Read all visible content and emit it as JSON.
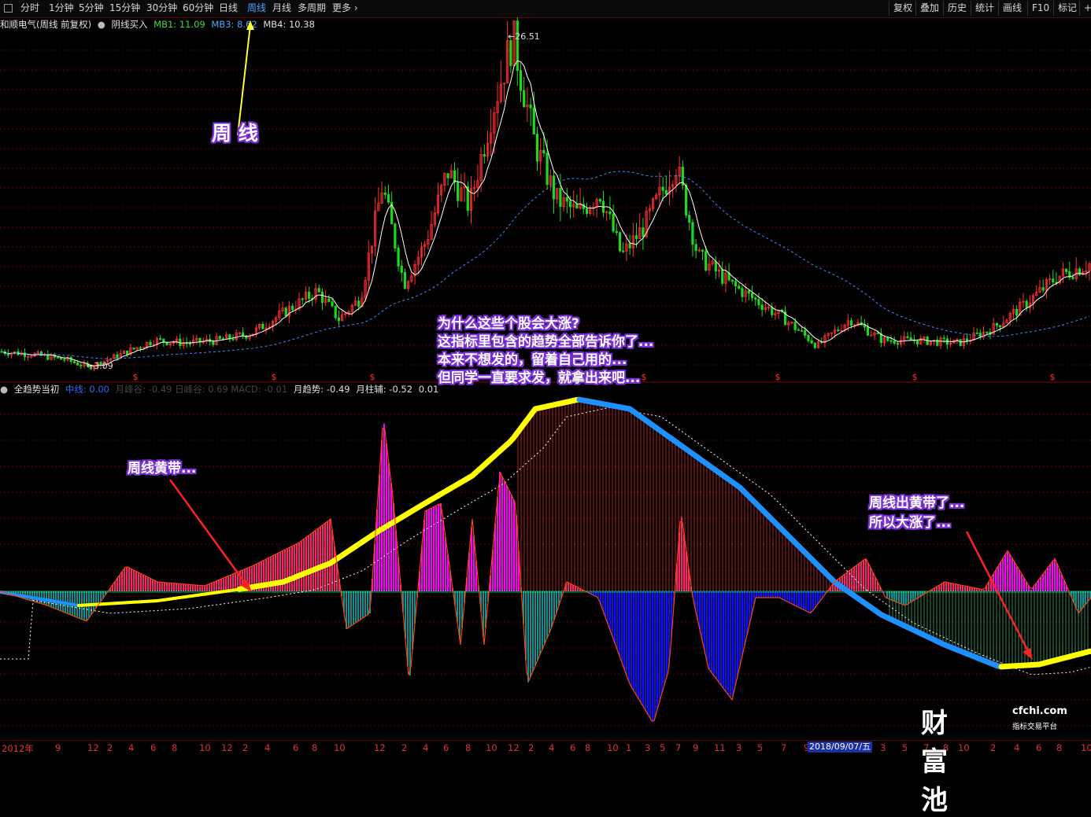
{
  "toolbar": {
    "periods": [
      "分时",
      "1分钟",
      "5分钟",
      "15分钟",
      "30分钟",
      "60分钟",
      "日线",
      "周线",
      "月线",
      "多周期",
      "更多"
    ],
    "active_period": "周线",
    "right_buttons": [
      "复权",
      "叠加",
      "历史",
      "统计",
      "画线",
      "F10",
      "标记",
      "+自"
    ]
  },
  "main_header": {
    "stock": "和顺电气(周线 前复权)",
    "indicator": "阴线买入",
    "mb1": "MB1: 11.09",
    "mb3": "MB3: 8.62",
    "mb4": "MB4: 10.38"
  },
  "sub_header": {
    "indicator": "全趋势当初",
    "zhongxian": "中线: 0.00",
    "hidden": "月峰谷: -0.49  日峰谷: 0.69  MACD: -0.01",
    "trend": "月趋势: -0.49",
    "bar": "月柱辅: -0.52",
    "extra": "0.01"
  },
  "annotations": {
    "weekly": "周 线",
    "question": [
      "为什么这些个股会大涨?",
      "这指标里包含的趋势全部告诉你了...",
      "本来不想发的，留着自己用的...",
      "但同学一直要求发，就拿出来吧..."
    ],
    "yellow_band": "周线黄带...",
    "yellow_out": [
      "周线出黄带了...",
      "所以大涨了..."
    ]
  },
  "price_labels": {
    "high": "26.51",
    "low": "3.09"
  },
  "dollar_marks": [
    "$",
    "$",
    "$",
    "$",
    "$",
    "$",
    "$"
  ],
  "axis": {
    "ticks": [
      "2012年",
      "9",
      "12",
      "2",
      "4",
      "6",
      "8",
      "10",
      "12",
      "2",
      "4",
      "6",
      "8",
      "10",
      "12",
      "2",
      "4",
      "6",
      "8",
      "10",
      "12",
      "2",
      "4",
      "6",
      "8",
      "10",
      "1",
      "3",
      "5",
      "7",
      "9",
      "11",
      "3",
      "5",
      "7",
      "9",
      "12",
      "3",
      "5",
      "7",
      "8",
      "10",
      "2",
      "4",
      "6",
      "8",
      "10",
      "12",
      "2",
      "4",
      "6",
      "8",
      "10"
    ],
    "date": "2018/09/07/五"
  },
  "logo": {
    "name": "财富池",
    "domain": "cfchi.com",
    "tagline": "指标交易平台"
  },
  "colors": {
    "up": "#ff3030",
    "down": "#00e0e0",
    "ma": "#ffffff",
    "yellow_band": "#ffff00",
    "blue_band": "#1e90ff",
    "magenta": "#ff00ff",
    "teal": "#008b8b",
    "dark_red": "#8b1a1a"
  },
  "chart_data": [
    {
      "type": "candlestick",
      "title": "和顺电气(周线 前复权)",
      "period": "weekly",
      "x_range": [
        "2012",
        "2019"
      ],
      "y_range": [
        3.09,
        26.51
      ],
      "annotated_high": 26.51,
      "annotated_low": 3.09,
      "ma_values": {
        "MB1": 11.09,
        "MB3": 8.62,
        "MB4": 10.38
      },
      "price_path": [
        [
          0,
          4.2
        ],
        [
          3,
          4.0
        ],
        [
          6,
          3.6
        ],
        [
          8,
          3.09
        ],
        [
          11,
          4.0
        ],
        [
          14,
          5.0
        ],
        [
          17,
          4.8
        ],
        [
          20,
          5.0
        ],
        [
          23,
          5.5
        ],
        [
          26,
          7.0
        ],
        [
          29,
          8.5
        ],
        [
          31,
          6.5
        ],
        [
          33,
          8.0
        ],
        [
          35,
          16.0
        ],
        [
          37,
          9.0
        ],
        [
          39,
          12.0
        ],
        [
          41,
          17.0
        ],
        [
          43,
          14.5
        ],
        [
          45,
          21.0
        ],
        [
          47,
          26.51
        ],
        [
          49,
          19.0
        ],
        [
          51,
          15.0
        ],
        [
          53,
          14.0
        ],
        [
          55,
          15.5
        ],
        [
          57,
          11.0
        ],
        [
          59,
          13.0
        ],
        [
          62,
          17.5
        ],
        [
          64,
          11.0
        ],
        [
          67,
          9.0
        ],
        [
          70,
          7.5
        ],
        [
          72,
          6.5
        ],
        [
          75,
          4.6
        ],
        [
          78,
          6.5
        ],
        [
          81,
          5.0
        ],
        [
          84,
          5.0
        ],
        [
          88,
          4.8
        ],
        [
          91,
          5.8
        ],
        [
          94,
          7.5
        ],
        [
          97,
          9.5
        ],
        [
          100,
          10.4
        ]
      ]
    },
    {
      "type": "bar",
      "title": "全趋势当初",
      "series": [
        {
          "name": "月趋势",
          "last": -0.49
        },
        {
          "name": "月柱辅",
          "last": -0.52
        }
      ]
    }
  ]
}
